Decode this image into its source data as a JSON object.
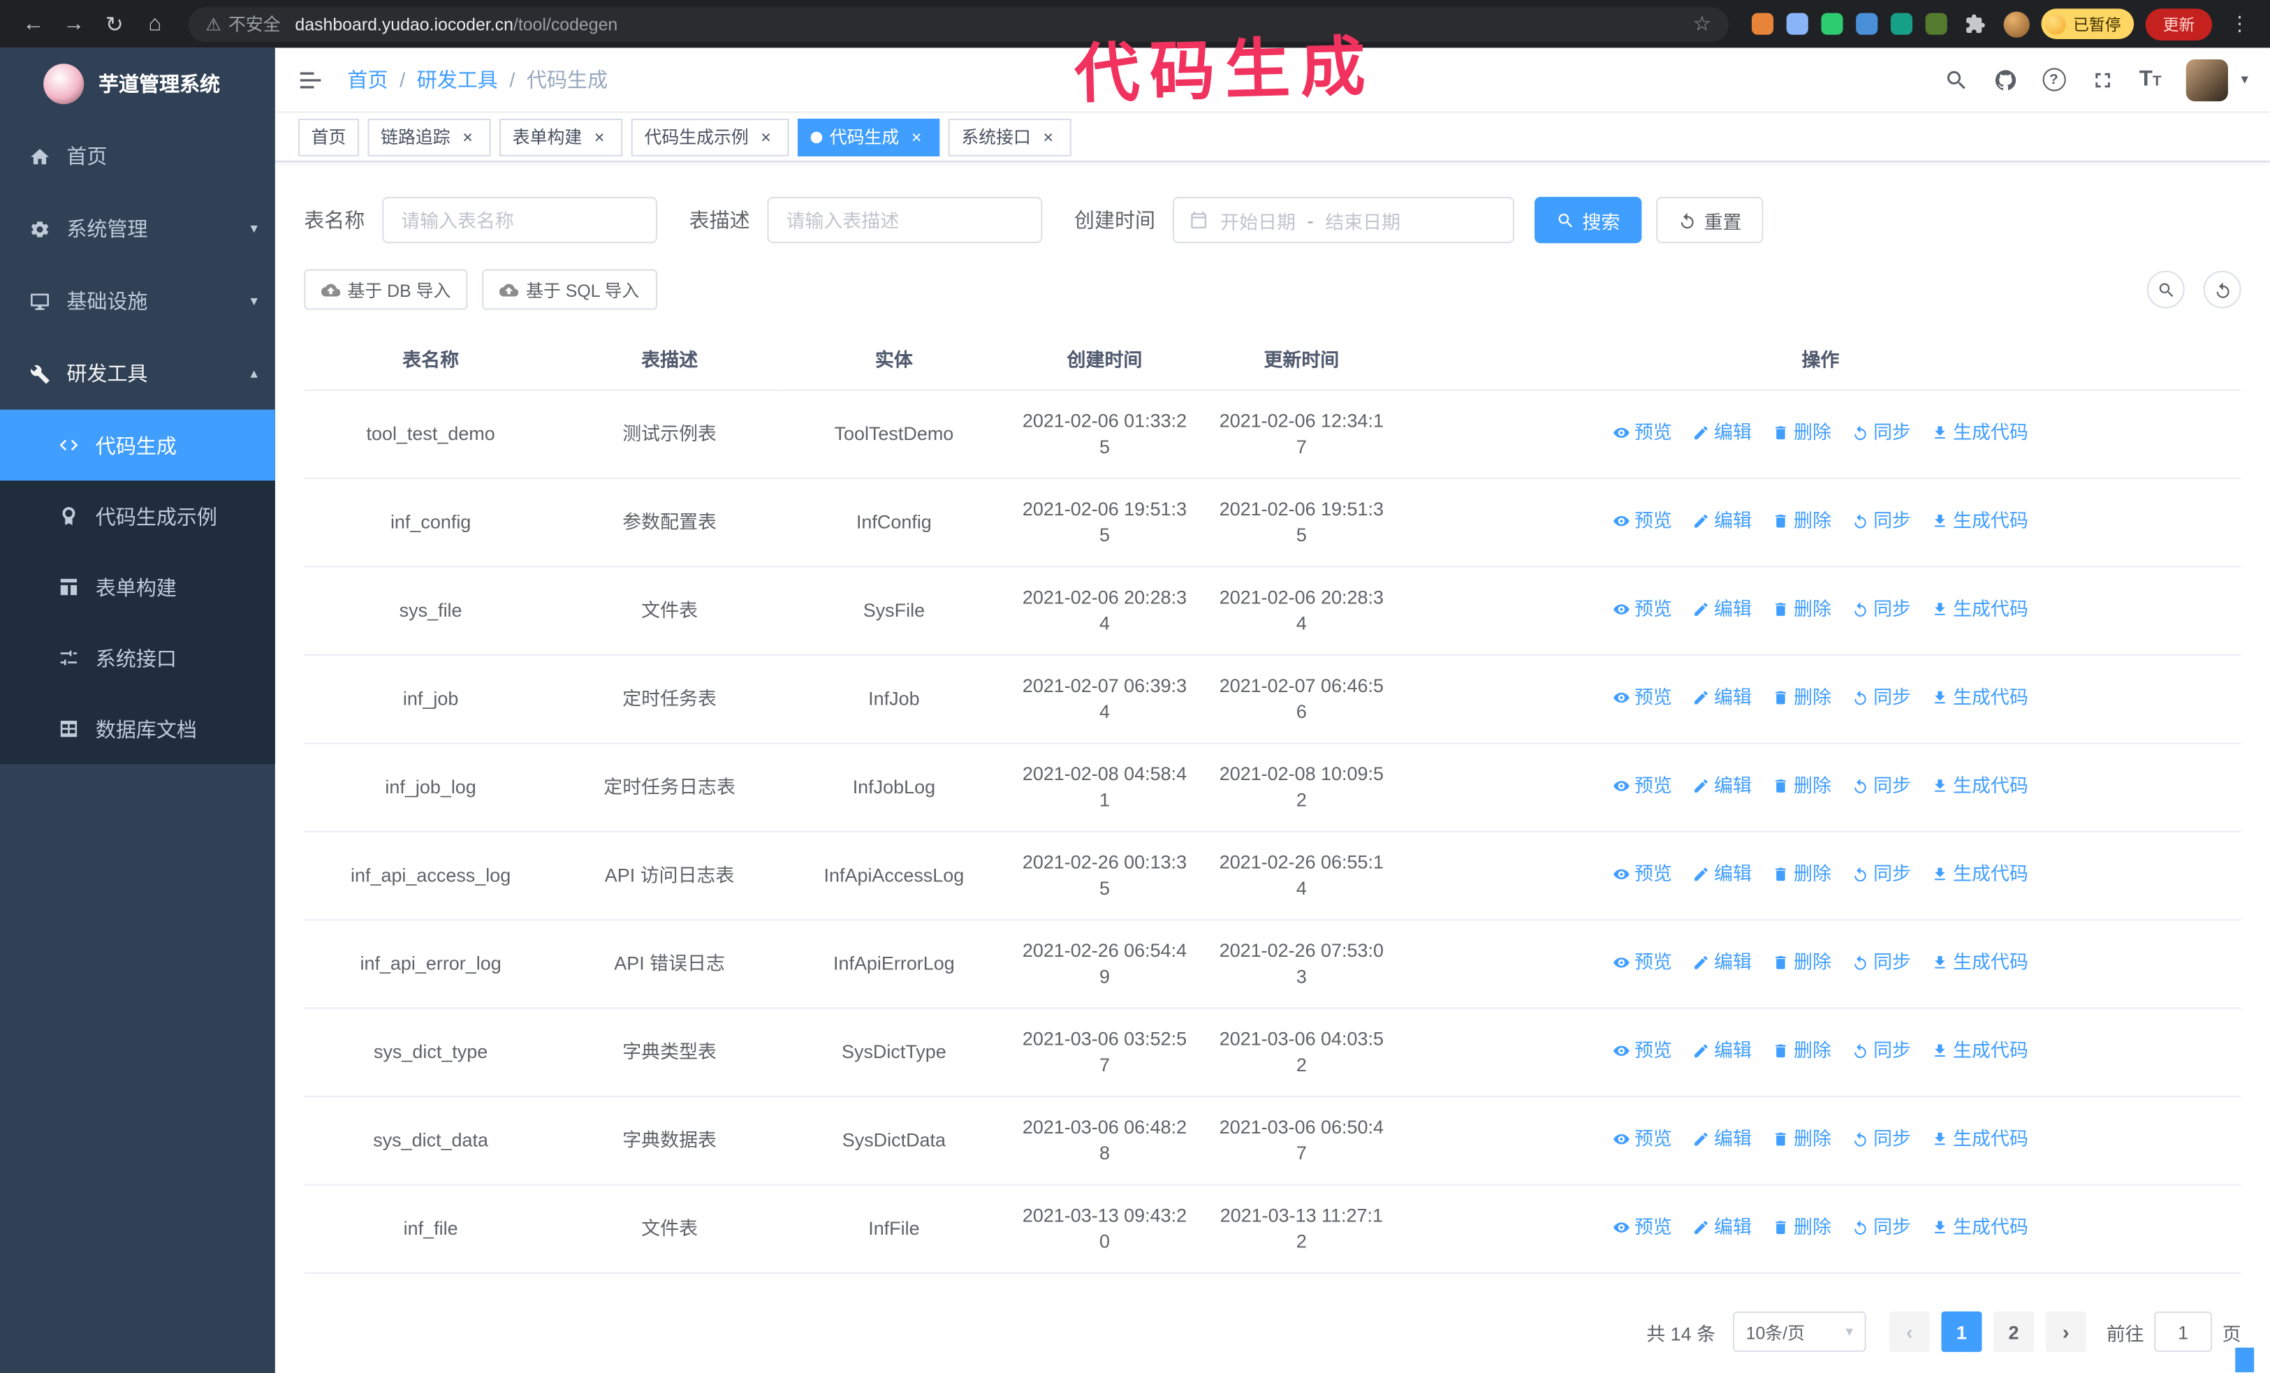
{
  "browser": {
    "security_label": "不安全",
    "url_host": "dashboard.yudao.iocoder.cn",
    "url_path": "/tool/codegen",
    "paused_badge": "已暂停",
    "update_button": "更新",
    "extensions": [
      {
        "name": "extension-icon-1",
        "color": "#e8833a"
      },
      {
        "name": "extension-icon-2",
        "color": "#8ab4f8"
      },
      {
        "name": "extension-icon-3",
        "color": "#2ecc71"
      },
      {
        "name": "extension-icon-4",
        "color": "#4a90d9"
      },
      {
        "name": "extension-icon-5",
        "color": "#16a085"
      },
      {
        "name": "extension-icon-6",
        "color": "#557b2f"
      }
    ]
  },
  "annotation": {
    "text": "代码生成",
    "color": "#f1325e"
  },
  "theme": {
    "primary": "#409eff",
    "sidebar_bg": "#304156",
    "submenu_bg": "#1f2d3d"
  },
  "sidebar": {
    "logo_title": "芋道管理系统",
    "items": [
      {
        "id": "home",
        "label": "首页",
        "icon": "home-icon",
        "expandable": false,
        "expanded": false
      },
      {
        "id": "system",
        "label": "系统管理",
        "icon": "gear-icon",
        "expandable": true,
        "expanded": false
      },
      {
        "id": "infra",
        "label": "基础设施",
        "icon": "monitor-icon",
        "expandable": true,
        "expanded": false
      },
      {
        "id": "devtools",
        "label": "研发工具",
        "icon": "wrench-icon",
        "expandable": true,
        "expanded": true
      }
    ],
    "subitems": [
      {
        "id": "codegen",
        "label": "代码生成",
        "icon": "code-icon",
        "active": true
      },
      {
        "id": "codegen-example",
        "label": "代码生成示例",
        "icon": "medal-icon",
        "active": false
      },
      {
        "id": "form-builder",
        "label": "表单构建",
        "icon": "form-icon",
        "active": false
      },
      {
        "id": "system-api",
        "label": "系统接口",
        "icon": "sliders-icon",
        "active": false
      },
      {
        "id": "db-doc",
        "label": "数据库文档",
        "icon": "table-icon",
        "active": false
      }
    ]
  },
  "navbar": {
    "breadcrumb": [
      "首页",
      "研发工具",
      "代码生成"
    ],
    "separator": "/"
  },
  "tags": [
    {
      "id": "home",
      "label": "首页",
      "closable": false,
      "active": false
    },
    {
      "id": "tracer",
      "label": "链路追踪",
      "closable": true,
      "active": false
    },
    {
      "id": "form-builder",
      "label": "表单构建",
      "closable": true,
      "active": false
    },
    {
      "id": "codegen-example",
      "label": "代码生成示例",
      "closable": true,
      "active": false
    },
    {
      "id": "codegen",
      "label": "代码生成",
      "closable": true,
      "active": true
    },
    {
      "id": "system-api",
      "label": "系统接口",
      "closable": true,
      "active": false
    }
  ],
  "filters": {
    "table_name_label": "表名称",
    "table_name_placeholder": "请输入表名称",
    "table_desc_label": "表描述",
    "table_desc_placeholder": "请输入表描述",
    "create_time_label": "创建时间",
    "date_start_placeholder": "开始日期",
    "date_separator": "-",
    "date_end_placeholder": "结束日期",
    "search_button": "搜索",
    "reset_button": "重置"
  },
  "toolbar": {
    "import_db_button": "基于 DB 导入",
    "import_sql_button": "基于 SQL 导入"
  },
  "table": {
    "headers": [
      "表名称",
      "表描述",
      "实体",
      "创建时间",
      "更新时间",
      "操作"
    ],
    "action_labels": [
      "预览",
      "编辑",
      "删除",
      "同步",
      "生成代码"
    ],
    "rows": [
      {
        "name": "tool_test_demo",
        "desc": "测试示例表",
        "entity": "ToolTestDemo",
        "created": "2021-02-06 01:33:25",
        "updated": "2021-02-06 12:34:17"
      },
      {
        "name": "inf_config",
        "desc": "参数配置表",
        "entity": "InfConfig",
        "created": "2021-02-06 19:51:35",
        "updated": "2021-02-06 19:51:35"
      },
      {
        "name": "sys_file",
        "desc": "文件表",
        "entity": "SysFile",
        "created": "2021-02-06 20:28:34",
        "updated": "2021-02-06 20:28:34"
      },
      {
        "name": "inf_job",
        "desc": "定时任务表",
        "entity": "InfJob",
        "created": "2021-02-07 06:39:34",
        "updated": "2021-02-07 06:46:56"
      },
      {
        "name": "inf_job_log",
        "desc": "定时任务日志表",
        "entity": "InfJobLog",
        "created": "2021-02-08 04:58:41",
        "updated": "2021-02-08 10:09:52"
      },
      {
        "name": "inf_api_access_log",
        "desc": "API 访问日志表",
        "entity": "InfApiAccessLog",
        "created": "2021-02-26 00:13:35",
        "updated": "2021-02-26 06:55:14"
      },
      {
        "name": "inf_api_error_log",
        "desc": "API 错误日志",
        "entity": "InfApiErrorLog",
        "created": "2021-02-26 06:54:49",
        "updated": "2021-02-26 07:53:03"
      },
      {
        "name": "sys_dict_type",
        "desc": "字典类型表",
        "entity": "SysDictType",
        "created": "2021-03-06 03:52:57",
        "updated": "2021-03-06 04:03:52"
      },
      {
        "name": "sys_dict_data",
        "desc": "字典数据表",
        "entity": "SysDictData",
        "created": "2021-03-06 06:48:28",
        "updated": "2021-03-06 06:50:47"
      },
      {
        "name": "inf_file",
        "desc": "文件表",
        "entity": "InfFile",
        "created": "2021-03-13 09:43:20",
        "updated": "2021-03-13 11:27:12"
      }
    ]
  },
  "pagination": {
    "total_text": "共 14 条",
    "page_size_text": "10条/页",
    "pages": [
      "1",
      "2"
    ],
    "current_page": "1",
    "goto_label": "前往",
    "goto_value": "1",
    "goto_unit": "页"
  }
}
